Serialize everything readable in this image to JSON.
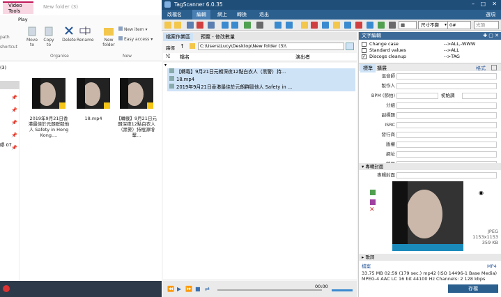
{
  "explorer": {
    "tab_video_tools": "Video Tools",
    "tab_play": "Play",
    "title": "New folder (3)",
    "ribbon": {
      "path": "path",
      "shortcut": "shortcut",
      "move_to": "Move to",
      "copy_to": "Copy to",
      "delete": "Delete",
      "rename": "Rename",
      "new_folder": "New folder",
      "new_item": "New item",
      "easy_access": "Easy access",
      "organise": "Organise",
      "new": "New"
    },
    "nav_fragment": "(3)",
    "nav_item_fragment": "磟 07",
    "files": [
      {
        "caption": "2019年9月21日香港最佳於元朗群毆他人 Safety in Hong Kong....",
        "badge": "icon"
      },
      {
        "caption": "18.mp4",
        "badge": "icon"
      },
      {
        "caption": "【轉載】9月21日元朗深夜12點白衣人（黑警）持棍源增擊...",
        "badge": "icon"
      }
    ]
  },
  "ts": {
    "title": "TagScanner 6.0.35",
    "menu": [
      "改檔名",
      "編輯",
      "網上",
      "轉換",
      "退出"
    ],
    "menu_right": "選項",
    "toolbar": {
      "keep_size": "尺寸不變",
      "zero": "0#",
      "optional": "光頂"
    },
    "panel_tabs": [
      "檔案作業區",
      "預覽 - 修改數量"
    ],
    "path_label": "路徑",
    "path": "C:\\Users\\Lucy\\Desktop\\New folder (3)\\",
    "col_file": "檔名",
    "col_performer": "演出者",
    "files": [
      "【轉載】9月21日元朗深夜12點白衣人（黑警）持...",
      "18.mp4",
      "2019年9月21日香港最佳於元朗群毆他人 Safety in ..."
    ],
    "time": "00:00",
    "text_edit_title": "文字編輯",
    "text_edit": [
      {
        "checked": false,
        "name": "Change case",
        "value": "-->ALL,-WWW"
      },
      {
        "checked": false,
        "name": "Standard values",
        "value": "-->ALL"
      },
      {
        "checked": true,
        "name": "Discogs cleanup",
        "value": "-->TAG"
      }
    ],
    "tag_tabs": [
      "標準",
      "擴展"
    ],
    "tag_format": "格式",
    "fields": [
      "混音師",
      "製作人",
      "BPM (節拍)",
      "分組",
      "副標題",
      "ISRC",
      "發行商",
      "版權",
      "網址",
      "編碼"
    ],
    "initial_key": "初始調",
    "cover_section": "專輯封面",
    "cover_label": "專輯封面",
    "cover_info": [
      "JPEG",
      "1153x1153",
      "359 KB"
    ],
    "lyrics": "歌詞",
    "file_label": "檔案",
    "file_ext": "MP4",
    "info1": "33.75 MB  02:59 (179 sec.)  mp42 (ISO 14496-1 Base Media)",
    "info2": "MPEG-4 AAC LC  16 bit  44100 Hz  Channels: 2  128 kbps",
    "save": "存檔"
  }
}
